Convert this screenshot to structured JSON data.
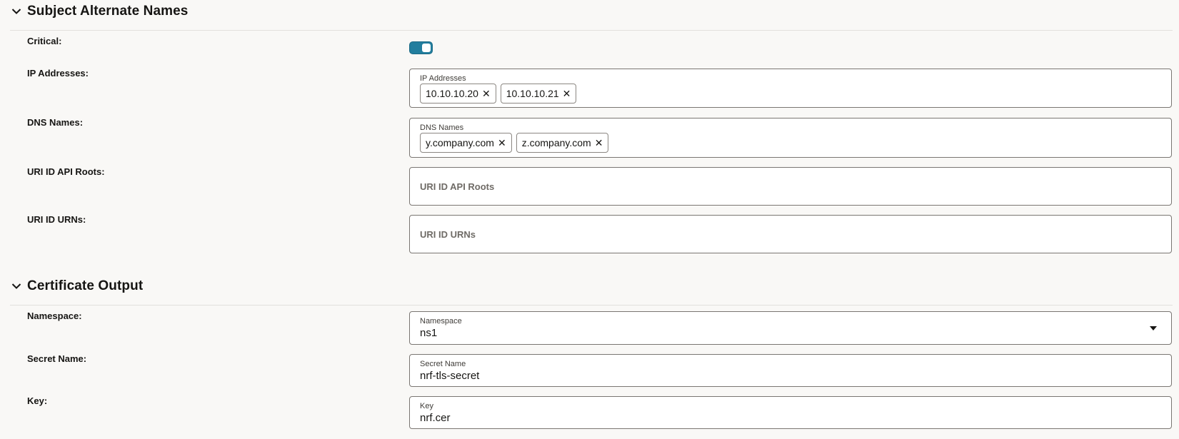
{
  "san_section": {
    "title": "Subject Alternate Names",
    "critical_label": "Critical:",
    "critical_enabled": true,
    "ip_row_label": "IP Addresses:",
    "ip_field_label": "IP Addresses",
    "ip_chips": [
      "10.10.10.20",
      "10.10.10.21"
    ],
    "dns_row_label": "DNS Names:",
    "dns_field_label": "DNS Names",
    "dns_chips": [
      "y.company.com",
      "z.company.com"
    ],
    "uri_api_row_label": "URI ID API Roots:",
    "uri_api_placeholder": "URI ID API Roots",
    "uri_urn_row_label": "URI ID URNs:",
    "uri_urn_placeholder": "URI ID URNs"
  },
  "output_section": {
    "title": "Certificate Output",
    "namespace_row_label": "Namespace:",
    "namespace_field_label": "Namespace",
    "namespace_value": "ns1",
    "secret_row_label": "Secret Name:",
    "secret_field_label": "Secret Name",
    "secret_value": "nrf-tls-secret",
    "key_row_label": "Key:",
    "key_field_label": "Key",
    "key_value": "nrf.cer"
  },
  "icons": {
    "collapse": "chevron-down-icon",
    "remove_chip": "close-icon",
    "dropdown": "caret-down-icon"
  },
  "colors": {
    "toggle_on": "#227e9e",
    "background": "#f9f8f6",
    "field_border": "#7a7672"
  }
}
